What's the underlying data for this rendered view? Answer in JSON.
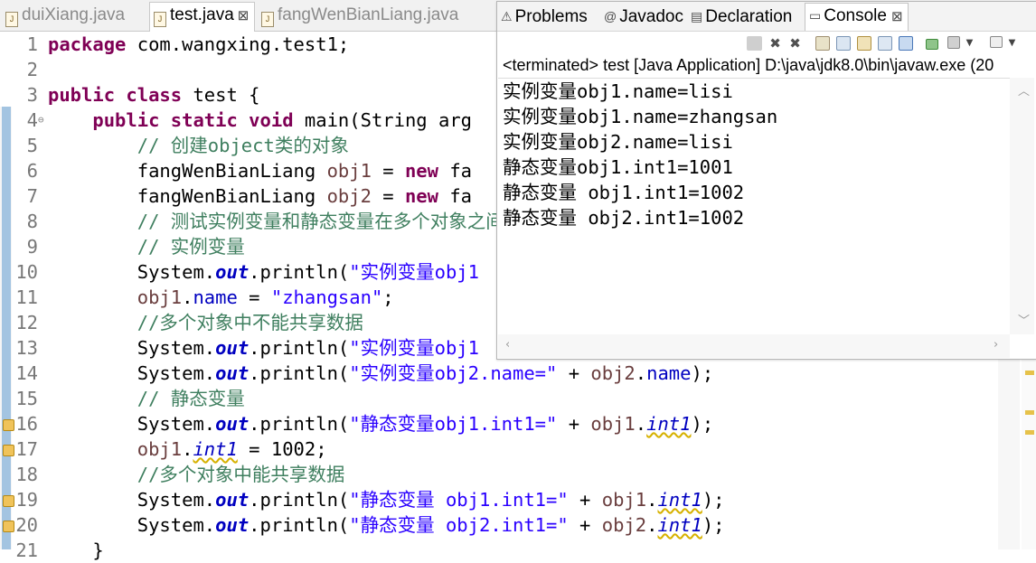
{
  "editor": {
    "tabs": [
      {
        "label": "duiXiang.java",
        "active": false
      },
      {
        "label": "test.java",
        "active": true
      },
      {
        "label": "fangWenBianLiang.java",
        "active": false
      }
    ],
    "close_glyph": "⊠",
    "lines": [
      {
        "n": "1",
        "code": [
          {
            "t": "kw",
            "v": "package"
          },
          {
            "t": "",
            "v": " com.wangxing.test1;"
          }
        ]
      },
      {
        "n": "2",
        "code": []
      },
      {
        "n": "3",
        "code": [
          {
            "t": "kw",
            "v": "public class"
          },
          {
            "t": "",
            "v": " test {"
          }
        ]
      },
      {
        "n": "4",
        "fold": "⊖",
        "code": [
          {
            "t": "",
            "v": "    "
          },
          {
            "t": "kw",
            "v": "public static void"
          },
          {
            "t": "",
            "v": " main(String arg"
          }
        ]
      },
      {
        "n": "5",
        "code": [
          {
            "t": "",
            "v": "        "
          },
          {
            "t": "cm",
            "v": "// 创建object类的对象"
          }
        ]
      },
      {
        "n": "6",
        "code": [
          {
            "t": "",
            "v": "        fangWenBianLiang "
          },
          {
            "t": "var",
            "v": "obj1"
          },
          {
            "t": "",
            "v": " = "
          },
          {
            "t": "kw",
            "v": "new"
          },
          {
            "t": "",
            "v": " fa"
          }
        ]
      },
      {
        "n": "7",
        "code": [
          {
            "t": "",
            "v": "        fangWenBianLiang "
          },
          {
            "t": "var",
            "v": "obj2"
          },
          {
            "t": "",
            "v": " = "
          },
          {
            "t": "kw",
            "v": "new"
          },
          {
            "t": "",
            "v": " fa"
          }
        ]
      },
      {
        "n": "8",
        "code": [
          {
            "t": "",
            "v": "        "
          },
          {
            "t": "cm",
            "v": "// 测试实例变量和静态变量在多个对象之间数"
          }
        ]
      },
      {
        "n": "9",
        "code": [
          {
            "t": "",
            "v": "        "
          },
          {
            "t": "cm",
            "v": "// 实例变量"
          }
        ]
      },
      {
        "n": "10",
        "code": [
          {
            "t": "",
            "v": "        System."
          },
          {
            "t": "sfld",
            "v": "out"
          },
          {
            "t": "",
            "v": ".println("
          },
          {
            "t": "str",
            "v": "\"实例变量obj1"
          }
        ]
      },
      {
        "n": "11",
        "code": [
          {
            "t": "",
            "v": "        "
          },
          {
            "t": "var",
            "v": "obj1"
          },
          {
            "t": "",
            "v": "."
          },
          {
            "t": "fld",
            "v": "name"
          },
          {
            "t": "",
            "v": " = "
          },
          {
            "t": "str",
            "v": "\"zhangsan\""
          },
          {
            "t": "",
            "v": ";"
          }
        ]
      },
      {
        "n": "12",
        "code": [
          {
            "t": "",
            "v": "        "
          },
          {
            "t": "cm",
            "v": "//多个对象中不能共享数据"
          }
        ]
      },
      {
        "n": "13",
        "code": [
          {
            "t": "",
            "v": "        System."
          },
          {
            "t": "sfld",
            "v": "out"
          },
          {
            "t": "",
            "v": ".println("
          },
          {
            "t": "str",
            "v": "\"实例变量obj1"
          }
        ]
      },
      {
        "n": "14",
        "code": [
          {
            "t": "",
            "v": "        System."
          },
          {
            "t": "sfld",
            "v": "out"
          },
          {
            "t": "",
            "v": ".println("
          },
          {
            "t": "str",
            "v": "\"实例变量obj2.name=\""
          },
          {
            "t": "",
            "v": " + "
          },
          {
            "t": "var",
            "v": "obj2"
          },
          {
            "t": "",
            "v": "."
          },
          {
            "t": "fld",
            "v": "name"
          },
          {
            "t": "",
            "v": ");"
          }
        ]
      },
      {
        "n": "15",
        "code": [
          {
            "t": "",
            "v": "        "
          },
          {
            "t": "cm",
            "v": "// 静态变量"
          }
        ]
      },
      {
        "n": "16",
        "warn": true,
        "code": [
          {
            "t": "",
            "v": "        System."
          },
          {
            "t": "sfld",
            "v": "out"
          },
          {
            "t": "",
            "v": ".println("
          },
          {
            "t": "str",
            "v": "\"静态变量obj1.int1=\""
          },
          {
            "t": "",
            "v": " + "
          },
          {
            "t": "var",
            "v": "obj1"
          },
          {
            "t": "",
            "v": "."
          },
          {
            "t": "sfi",
            "v": "int1"
          },
          {
            "t": "",
            "v": ");"
          }
        ]
      },
      {
        "n": "17",
        "warn": true,
        "code": [
          {
            "t": "",
            "v": "        "
          },
          {
            "t": "var",
            "v": "obj1"
          },
          {
            "t": "",
            "v": "."
          },
          {
            "t": "sfi",
            "v": "int1"
          },
          {
            "t": "",
            "v": " = 1002;"
          }
        ]
      },
      {
        "n": "18",
        "code": [
          {
            "t": "",
            "v": "        "
          },
          {
            "t": "cm",
            "v": "//多个对象中能共享数据"
          }
        ]
      },
      {
        "n": "19",
        "warn": true,
        "code": [
          {
            "t": "",
            "v": "        System."
          },
          {
            "t": "sfld",
            "v": "out"
          },
          {
            "t": "",
            "v": ".println("
          },
          {
            "t": "str",
            "v": "\"静态变量 obj1.int1=\""
          },
          {
            "t": "",
            "v": " + "
          },
          {
            "t": "var",
            "v": "obj1"
          },
          {
            "t": "",
            "v": "."
          },
          {
            "t": "sfi",
            "v": "int1"
          },
          {
            "t": "",
            "v": ");"
          }
        ]
      },
      {
        "n": "20",
        "warn": true,
        "code": [
          {
            "t": "",
            "v": "        System."
          },
          {
            "t": "sfld",
            "v": "out"
          },
          {
            "t": "",
            "v": ".println("
          },
          {
            "t": "str",
            "v": "\"静态变量 obj2.int1=\""
          },
          {
            "t": "",
            "v": " + "
          },
          {
            "t": "var",
            "v": "obj2"
          },
          {
            "t": "",
            "v": "."
          },
          {
            "t": "sfi",
            "v": "int1"
          },
          {
            "t": "",
            "v": ");"
          }
        ]
      },
      {
        "n": "21",
        "code": [
          {
            "t": "",
            "v": "    }"
          }
        ]
      }
    ]
  },
  "console_view": {
    "tabs": [
      {
        "icon": "problems-icon",
        "glyph": "⚠",
        "label": "Problems"
      },
      {
        "icon": "javadoc-icon",
        "glyph": "@",
        "label": "Javadoc"
      },
      {
        "icon": "declaration-icon",
        "glyph": "▤",
        "label": "Declaration"
      },
      {
        "icon": "console-icon",
        "glyph": "▭",
        "label": "Console",
        "active": true
      }
    ],
    "close_glyph": "⊠",
    "terminated": "<terminated> test [Java Application] D:\\java\\jdk8.0\\bin\\javaw.exe (20",
    "output": [
      "实例变量obj1.name=lisi",
      "实例变量obj1.name=zhangsan",
      "实例变量obj2.name=lisi",
      "静态变量obj1.int1=1001",
      "静态变量 obj1.int1=1002",
      "静态变量 obj2.int1=1002"
    ],
    "toolbar_icons": [
      "terminate-icon",
      "remove-launch-icon",
      "remove-all-icon",
      "scroll-lock-icon",
      "word-wrap-icon",
      "pin-console-icon",
      "display-console-icon",
      "open-console-icon",
      "menu-icon"
    ],
    "colors": {
      "accent": "#5f9bd0",
      "keyword": "#7f0055",
      "string": "#2a00ff",
      "comment": "#3f7f5f",
      "field": "#0000c0"
    }
  }
}
